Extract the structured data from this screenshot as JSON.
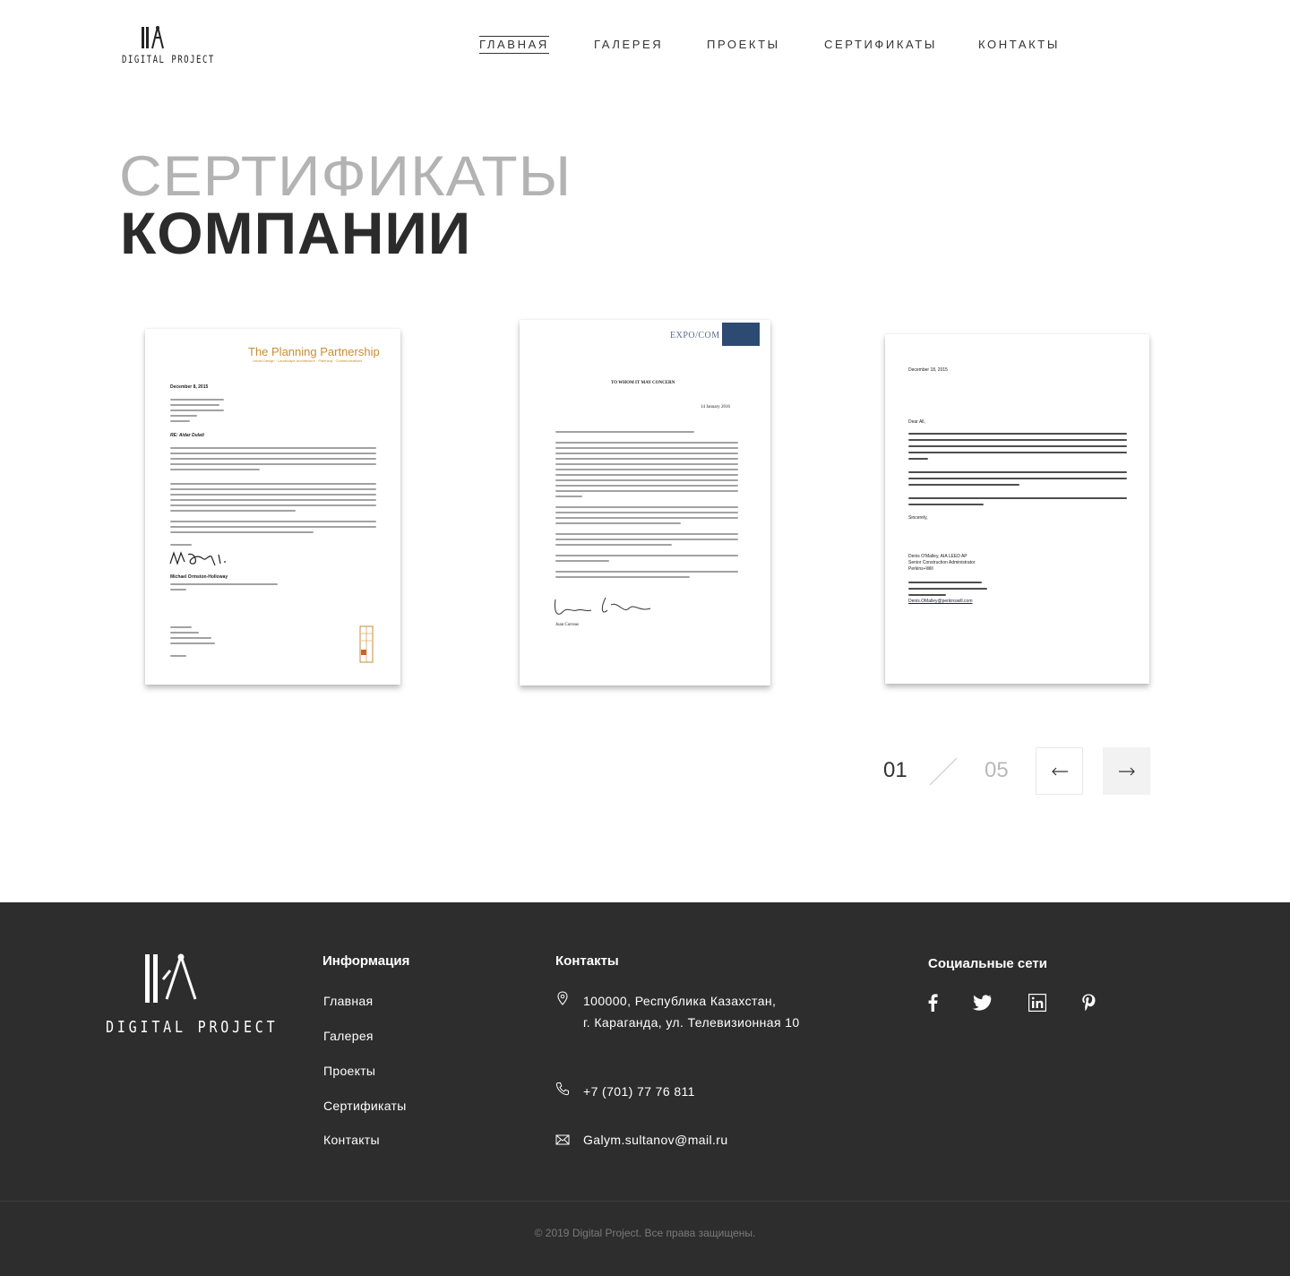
{
  "brand": {
    "name": "DIGITAL PROJECT"
  },
  "nav": {
    "items": [
      {
        "label": "ГЛАВНАЯ",
        "active": true
      },
      {
        "label": "ГАЛЕРЕЯ",
        "active": false
      },
      {
        "label": "ПРОЕКТЫ",
        "active": false
      },
      {
        "label": "СЕРТИФИКАТЫ",
        "active": false
      },
      {
        "label": "КОНТАКТЫ",
        "active": false
      }
    ]
  },
  "hero": {
    "title_light": "СЕРТИФИКАТЫ",
    "title_bold": "КОМПАНИИ"
  },
  "certificates": [
    {
      "logo": "The Planning Partnership",
      "logo_sub": "Urban Design · Landscape Architecture · Planning · Communications",
      "date": "December 8, 2015",
      "re": "RE: Aidar Dulati",
      "signer": "Michael Ormston-Holloway"
    },
    {
      "logo": "EXPO/COM",
      "heading": "TO WHOM IT MAY CONCERN",
      "date": "14 January 2016",
      "signer": "Juan Correas"
    },
    {
      "date": "December 18, 2015",
      "greeting": "Dear All,",
      "closing": "Sincerely,",
      "signer": "Denis O'Malley, AIA LEED AP",
      "signer_title": "Senior Construction Administrator",
      "signer_org": "Perkins+Will",
      "email": "Denis.OMalley@perkinswill.com"
    }
  ],
  "pager": {
    "current": "01",
    "total": "05",
    "prev_icon": "arrow-left-icon",
    "next_icon": "arrow-right-icon"
  },
  "footer": {
    "info_heading": "Информация",
    "links": [
      "Главная",
      "Галерея",
      "Проекты",
      "Сертификаты",
      "Контакты"
    ],
    "contacts_heading": "Контакты",
    "address_line1": "100000, Республика  Казахстан,",
    "address_line2": "г. Караганда, ул. Телевизионная 10",
    "phone": "+7 (701) 77 76 811",
    "email": "Galym.sultanov@mail.ru",
    "social_heading": "Социальные сети",
    "social": [
      "facebook-icon",
      "twitter-icon",
      "linkedin-icon",
      "pinterest-icon"
    ],
    "copyright": "© 2019 Digital Project. Все права защищены."
  },
  "colors": {
    "footer_bg": "#2d2d2d",
    "title_light": "#b3b3b3",
    "title_bold": "#2b2b2b",
    "accent_gold": "#c88c34"
  }
}
